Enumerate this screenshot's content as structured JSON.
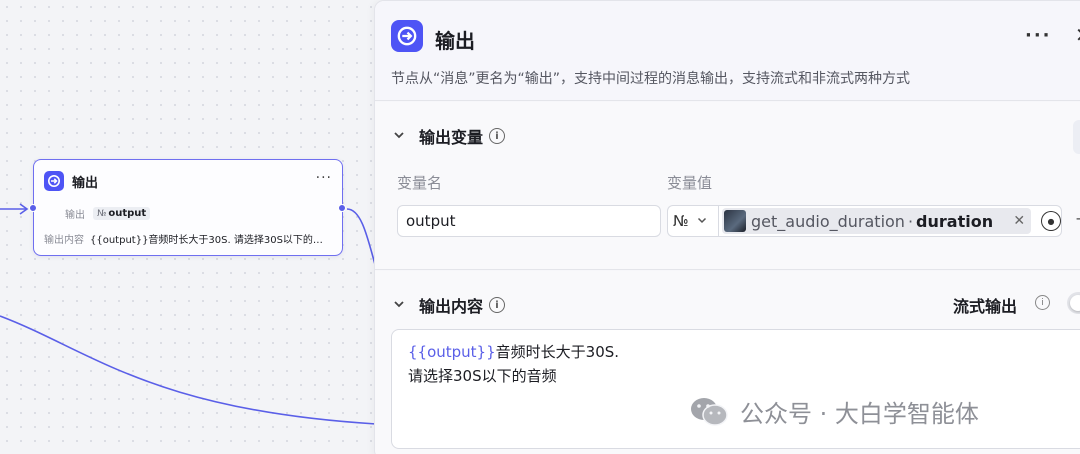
{
  "node": {
    "title": "输出",
    "more": "···",
    "output_label": "输出",
    "output_type": "№",
    "output_name": "output",
    "content_label": "输出内容",
    "content_preview": "{{output}}音频时长大于30S. 请选择30S以下的…"
  },
  "panel": {
    "title": "输出",
    "more": "···",
    "close": "✕",
    "description": "节点从“消息”更名为“输出”，支持中间过程的消息输出，支持流式和非流式两种方式",
    "vars_section": {
      "title": "输出变量",
      "col_name": "变量名",
      "col_value": "变量值",
      "var_name": "output",
      "var_type": "№",
      "ref_node": "get_audio_duration",
      "ref_sep": "·",
      "ref_field": "duration"
    },
    "content_section": {
      "title": "输出内容",
      "stream_label": "流式输出",
      "stream_enabled": false,
      "line1_var": "{{output}}",
      "line1_text": "音频时长大于30S.",
      "line2_text": "请选择30S以下的音频"
    }
  },
  "watermark": "公众号 · 大白学智能体",
  "colors": {
    "accent": "#4e54f5",
    "edge": "#5a5fe8"
  }
}
